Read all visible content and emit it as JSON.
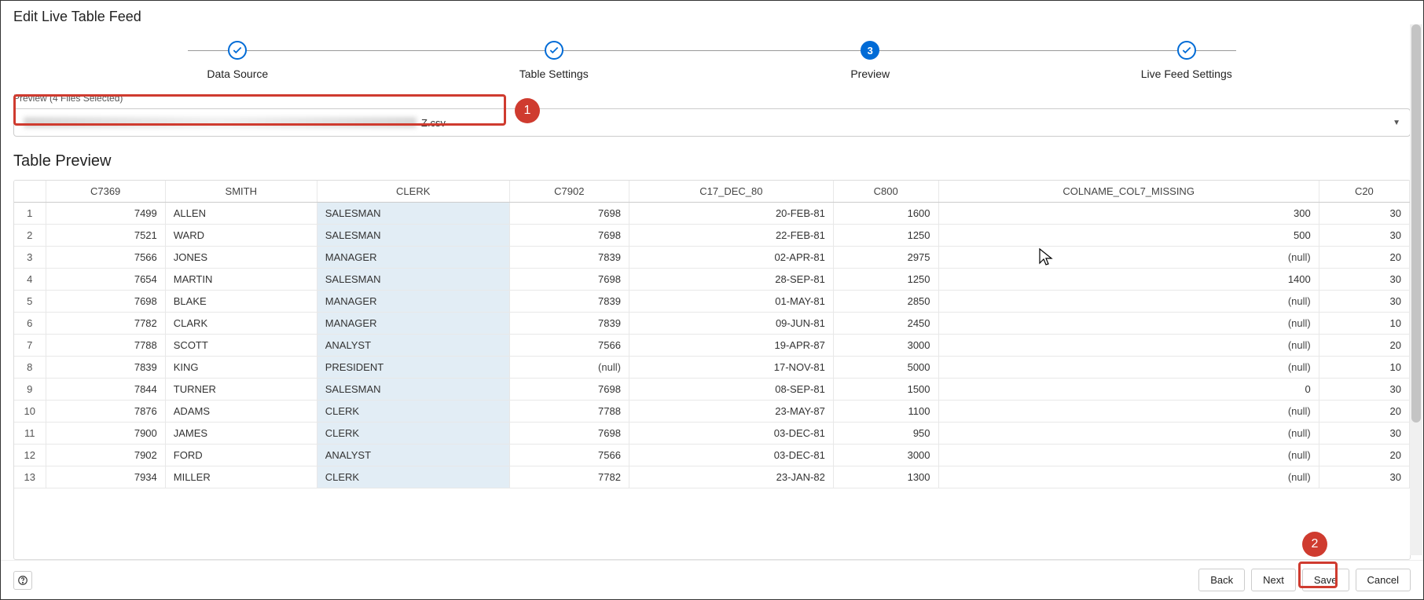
{
  "header": {
    "title": "Edit Live Table Feed"
  },
  "stepper": {
    "steps": [
      {
        "label": "Data Source",
        "state": "done"
      },
      {
        "label": "Table Settings",
        "state": "done"
      },
      {
        "label": "Preview",
        "state": "active",
        "number": "3"
      },
      {
        "label": "Live Feed Settings",
        "state": "done"
      }
    ]
  },
  "preview_selector": {
    "label": "Preview (4 Files Selected)",
    "file_suffix": "Z.csv"
  },
  "section": {
    "title": "Table Preview"
  },
  "table": {
    "headers": [
      "C7369",
      "SMITH",
      "CLERK",
      "C7902",
      "C17_DEC_80",
      "C800",
      "COLNAME_COL7_MISSING",
      "C20"
    ],
    "rows": [
      {
        "n": "1",
        "c": [
          "7499",
          "ALLEN",
          "SALESMAN",
          "7698",
          "20-FEB-81",
          "1600",
          "300",
          "30"
        ]
      },
      {
        "n": "2",
        "c": [
          "7521",
          "WARD",
          "SALESMAN",
          "7698",
          "22-FEB-81",
          "1250",
          "500",
          "30"
        ]
      },
      {
        "n": "3",
        "c": [
          "7566",
          "JONES",
          "MANAGER",
          "7839",
          "02-APR-81",
          "2975",
          "(null)",
          "20"
        ]
      },
      {
        "n": "4",
        "c": [
          "7654",
          "MARTIN",
          "SALESMAN",
          "7698",
          "28-SEP-81",
          "1250",
          "1400",
          "30"
        ]
      },
      {
        "n": "5",
        "c": [
          "7698",
          "BLAKE",
          "MANAGER",
          "7839",
          "01-MAY-81",
          "2850",
          "(null)",
          "30"
        ]
      },
      {
        "n": "6",
        "c": [
          "7782",
          "CLARK",
          "MANAGER",
          "7839",
          "09-JUN-81",
          "2450",
          "(null)",
          "10"
        ]
      },
      {
        "n": "7",
        "c": [
          "7788",
          "SCOTT",
          "ANALYST",
          "7566",
          "19-APR-87",
          "3000",
          "(null)",
          "20"
        ]
      },
      {
        "n": "8",
        "c": [
          "7839",
          "KING",
          "PRESIDENT",
          "(null)",
          "17-NOV-81",
          "5000",
          "(null)",
          "10"
        ]
      },
      {
        "n": "9",
        "c": [
          "7844",
          "TURNER",
          "SALESMAN",
          "7698",
          "08-SEP-81",
          "1500",
          "0",
          "30"
        ]
      },
      {
        "n": "10",
        "c": [
          "7876",
          "ADAMS",
          "CLERK",
          "7788",
          "23-MAY-87",
          "1100",
          "(null)",
          "20"
        ]
      },
      {
        "n": "11",
        "c": [
          "7900",
          "JAMES",
          "CLERK",
          "7698",
          "03-DEC-81",
          "950",
          "(null)",
          "30"
        ]
      },
      {
        "n": "12",
        "c": [
          "7902",
          "FORD",
          "ANALYST",
          "7566",
          "03-DEC-81",
          "3000",
          "(null)",
          "20"
        ]
      },
      {
        "n": "13",
        "c": [
          "7934",
          "MILLER",
          "CLERK",
          "7782",
          "23-JAN-82",
          "1300",
          "(null)",
          "30"
        ]
      }
    ]
  },
  "footer": {
    "back": "Back",
    "next": "Next",
    "save": "Save",
    "cancel": "Cancel"
  },
  "callouts": {
    "one": "1",
    "two": "2"
  }
}
